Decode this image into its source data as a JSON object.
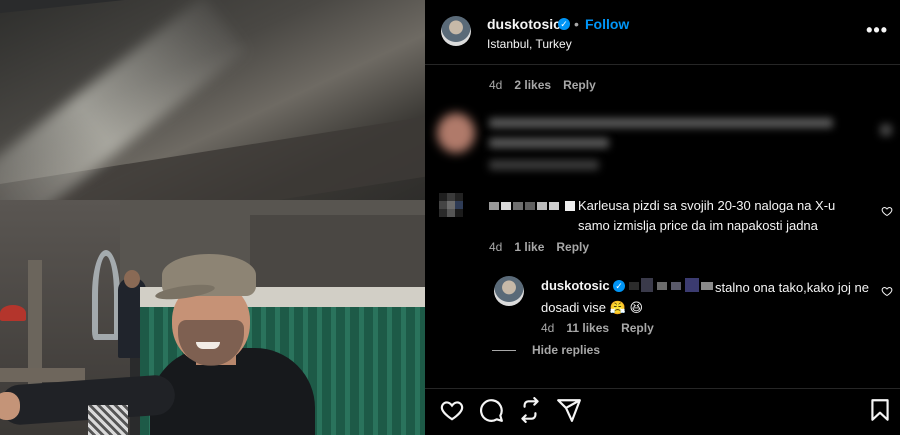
{
  "post": {
    "username": "duskotosic",
    "separator": "•",
    "follow_label": "Follow",
    "location": "Istanbul, Turkey",
    "more_label": "•••",
    "verified_mark": "✓"
  },
  "comment_top_meta": {
    "time": "4d",
    "likes": "2 likes",
    "reply": "Reply"
  },
  "comment_1": {
    "text": "Karleusa pizdi sa svojih 20-30 naloga na X-u samo izmislja price da im napakosti jadna",
    "time": "4d",
    "likes": "1 like",
    "reply": "Reply"
  },
  "reply_1": {
    "username": "duskotosic",
    "text": "stalno ona tako,kako joj ne dosadi vise",
    "emojis": "😤 😆",
    "time": "4d",
    "likes": "11 likes",
    "reply": "Reply"
  },
  "hide_replies": "Hide replies",
  "colors": {
    "accent": "#0095f6",
    "bg": "#000000",
    "text": "#f5f5f5",
    "muted": "#a8a8a8"
  },
  "icons": [
    "heart-icon",
    "comment-icon",
    "share-icon",
    "send-icon",
    "bookmark-icon",
    "more-icon",
    "verified-icon"
  ]
}
